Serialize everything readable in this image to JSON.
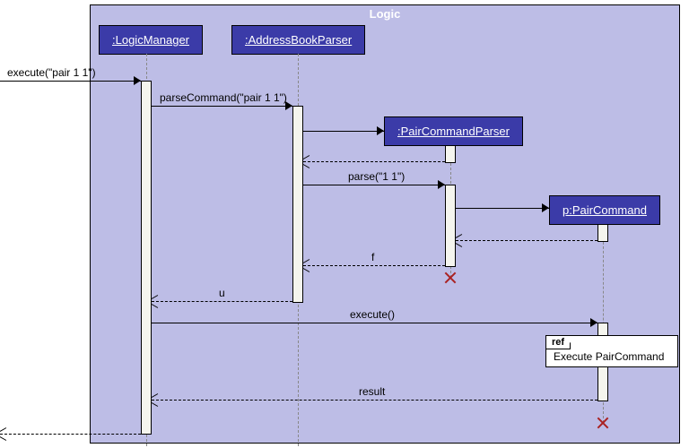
{
  "frame": {
    "name": "Logic"
  },
  "lifelines": {
    "logicManager": ":LogicManager",
    "addressBookParser": ":AddressBookParser",
    "pairCommandParser": ":PairCommandParser",
    "pairCommand": "p:PairCommand"
  },
  "messages": {
    "execute_in": "execute(\"pair 1 1\")",
    "parseCommand": "parseCommand(\"pair 1 1\")",
    "parse": "parse(\"1 1\")",
    "return_f": "f",
    "return_u": "u",
    "execute": "execute()",
    "return_result": "result"
  },
  "ref": {
    "tag": "ref",
    "text": "Execute PairCommand"
  },
  "chart_data": {
    "type": "diagram",
    "notation": "UML sequence diagram",
    "frame": "Logic",
    "lifelines": [
      {
        "id": "caller",
        "name": "(external caller)",
        "created_at": 0
      },
      {
        "id": "lm",
        "name": ":LogicManager",
        "created_at": 0
      },
      {
        "id": "abp",
        "name": ":AddressBookParser",
        "created_at": 0
      },
      {
        "id": "pcp",
        "name": ":PairCommandParser",
        "created_by": "abp"
      },
      {
        "id": "pc",
        "name": "p:PairCommand",
        "created_by": "pcp"
      }
    ],
    "messages": [
      {
        "from": "caller",
        "to": "lm",
        "label": "execute(\"pair 1 1\")",
        "type": "sync"
      },
      {
        "from": "lm",
        "to": "abp",
        "label": "parseCommand(\"pair 1 1\")",
        "type": "sync"
      },
      {
        "from": "abp",
        "to": "pcp",
        "label": "",
        "type": "create"
      },
      {
        "from": "pcp",
        "to": "abp",
        "label": "",
        "type": "return"
      },
      {
        "from": "abp",
        "to": "pcp",
        "label": "parse(\"1 1\")",
        "type": "sync"
      },
      {
        "from": "pcp",
        "to": "pc",
        "label": "",
        "type": "create"
      },
      {
        "from": "pc",
        "to": "pcp",
        "label": "",
        "type": "return"
      },
      {
        "from": "pcp",
        "to": "abp",
        "label": "f",
        "type": "return"
      },
      {
        "from": "pcp",
        "to": null,
        "label": "",
        "type": "destroy"
      },
      {
        "from": "abp",
        "to": "lm",
        "label": "u",
        "type": "return"
      },
      {
        "from": "lm",
        "to": "pc",
        "label": "execute()",
        "type": "sync"
      },
      {
        "from": "pc",
        "to": null,
        "label": "Execute PairCommand",
        "type": "ref"
      },
      {
        "from": "pc",
        "to": "lm",
        "label": "result",
        "type": "return"
      },
      {
        "from": "pc",
        "to": null,
        "label": "",
        "type": "destroy"
      },
      {
        "from": "lm",
        "to": "caller",
        "label": "",
        "type": "return"
      }
    ]
  }
}
